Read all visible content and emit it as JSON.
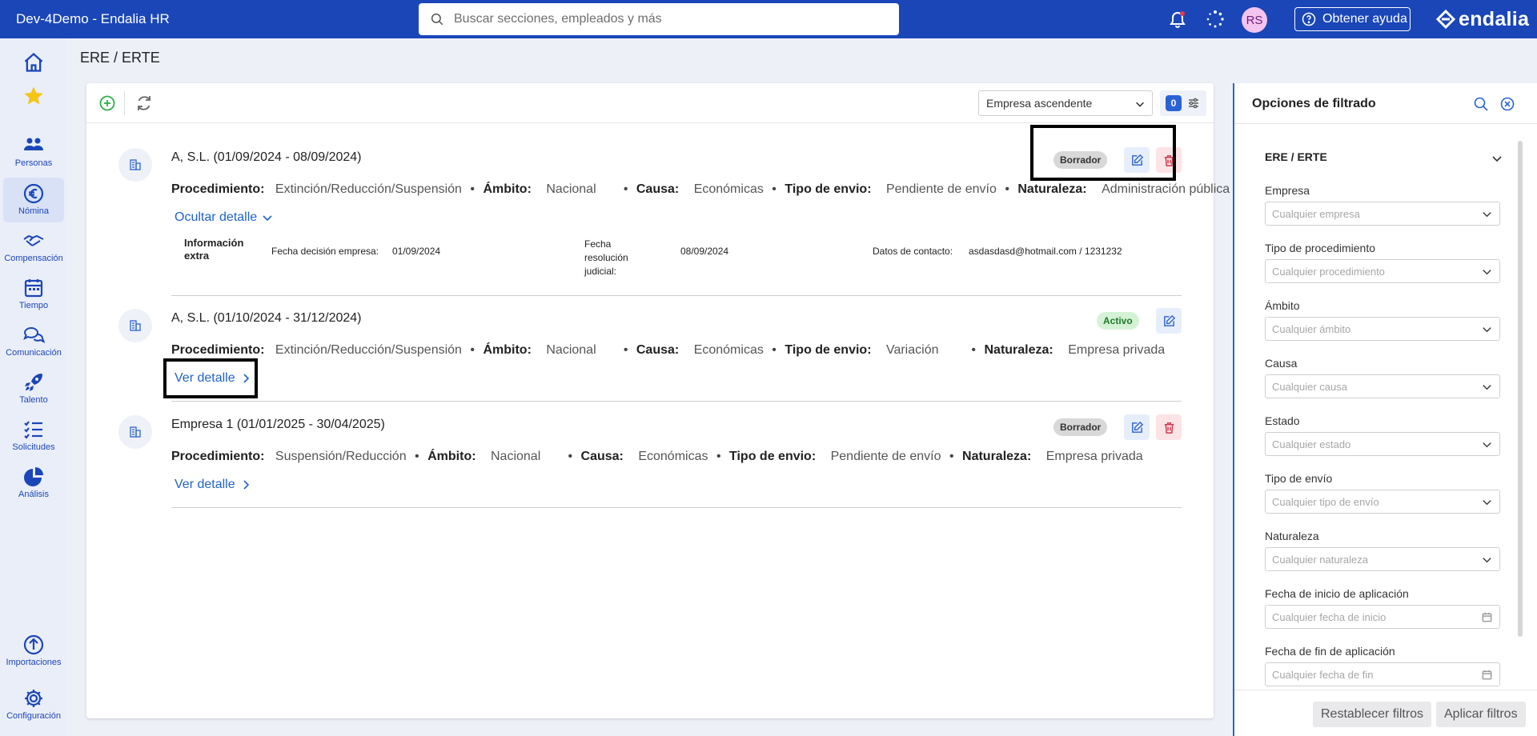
{
  "app": {
    "title": "Dev-4Demo - Endalia HR",
    "search_placeholder": "Buscar secciones, empleados y más",
    "avatar_initials": "RS",
    "help_label": "Obtener ayuda",
    "logo_text": "endalia"
  },
  "sidebar": {
    "items": [
      {
        "label": "",
        "icon": "home-icon"
      },
      {
        "label": "",
        "icon": "star-icon"
      },
      {
        "label": "Personas",
        "icon": "people-icon"
      },
      {
        "label": "Nómina",
        "icon": "euro-icon"
      },
      {
        "label": "Compensación",
        "icon": "handshake-icon"
      },
      {
        "label": "Tiempo",
        "icon": "calendar-icon"
      },
      {
        "label": "Comunicación",
        "icon": "chat-icon"
      },
      {
        "label": "Talento",
        "icon": "rocket-icon"
      },
      {
        "label": "Solicitudes",
        "icon": "checklist-icon"
      },
      {
        "label": "Análisis",
        "icon": "pie-chart-icon"
      },
      {
        "label": "Importaciones",
        "icon": "upload-icon"
      },
      {
        "label": "Configuración",
        "icon": "gear-icon"
      }
    ]
  },
  "page": {
    "title": "ERE / ERTE",
    "sort_value": "Empresa ascendente",
    "filter_count": "0"
  },
  "labels": {
    "procedimiento": "Procedimiento:",
    "ambito": "Ámbito:",
    "causa": "Causa:",
    "tipo_envio": "Tipo de envio:",
    "naturaleza": "Naturaleza:",
    "dot": "•"
  },
  "records": [
    {
      "title": "A, S.L. (01/09/2024 - 08/09/2024)",
      "status": "Borrador",
      "procedimiento": "Extinción/Reducción/Suspensión",
      "ambito": "Nacional",
      "causa": "Económicas",
      "tipo_envio": "Pendiente de envío",
      "naturaleza": "Administración pública",
      "detail_link": "Ocultar detalle",
      "extra": {
        "title": "Información extra",
        "fecha_decision_label": "Fecha decisión empresa:",
        "fecha_decision": "01/09/2024",
        "fecha_resolucion_label": "Fecha resolución judicial:",
        "fecha_resolucion": "08/09/2024",
        "contacto_label": "Datos de contacto:",
        "contacto": "asdasdasd@hotmail.com / 1231232"
      }
    },
    {
      "title": "A, S.L. (01/10/2024 - 31/12/2024)",
      "status": "Activo",
      "procedimiento": "Extinción/Reducción/Suspensión",
      "ambito": "Nacional",
      "causa": "Económicas",
      "tipo_envio": "Variación",
      "naturaleza": "Empresa privada",
      "detail_link": "Ver detalle"
    },
    {
      "title": "Empresa 1 (01/01/2025 - 30/04/2025)",
      "status": "Borrador",
      "procedimiento": "Suspensión/Reducción",
      "ambito": "Nacional",
      "causa": "Económicas",
      "tipo_envio": "Pendiente de envío",
      "naturaleza": "Empresa privada",
      "detail_link": "Ver detalle"
    }
  ],
  "filters": {
    "title": "Opciones de filtrado",
    "section": "ERE / ERTE",
    "fields": [
      {
        "label": "Empresa",
        "placeholder": "Cualquier empresa",
        "type": "select"
      },
      {
        "label": "Tipo de procedimiento",
        "placeholder": "Cualquier procedimiento",
        "type": "select"
      },
      {
        "label": "Ámbito",
        "placeholder": "Cualquier ámbito",
        "type": "select"
      },
      {
        "label": "Causa",
        "placeholder": "Cualquier causa",
        "type": "select"
      },
      {
        "label": "Estado",
        "placeholder": "Cualquier estado",
        "type": "select"
      },
      {
        "label": "Tipo de envío",
        "placeholder": "Cualquier tipo de envío",
        "type": "select"
      },
      {
        "label": "Naturaleza",
        "placeholder": "Cualquier naturaleza",
        "type": "select"
      },
      {
        "label": "Fecha de inicio de aplicación",
        "placeholder": "Cualquier fecha de inicio",
        "type": "date"
      },
      {
        "label": "Fecha de fin de aplicación",
        "placeholder": "Cualquier fecha de fin",
        "type": "date"
      }
    ],
    "reset_label": "Restablecer filtros",
    "apply_label": "Aplicar filtros"
  },
  "colors": {
    "brand": "#1a46b8",
    "link": "#1f63c9",
    "delete": "#d0344a",
    "add": "#2fae48"
  }
}
